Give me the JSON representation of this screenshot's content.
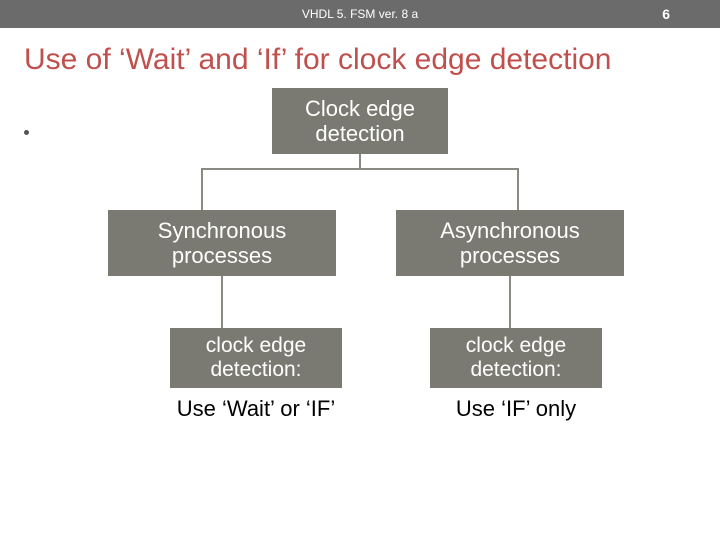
{
  "header": {
    "title": "VHDL 5. FSM ver. 8 a",
    "page_number": "6"
  },
  "slide": {
    "title": "Use of ‘Wait’ and ‘If’ for clock edge detection"
  },
  "diagram": {
    "root": "Clock edge detection",
    "level2": {
      "left": "Synchronous processes",
      "right": "Asynchronous processes"
    },
    "level3": {
      "left": "clock edge detection:",
      "right": "clock edge detection:"
    },
    "caption": {
      "left": "Use ‘Wait’ or ‘IF’",
      "right": "Use ‘IF’ only"
    }
  }
}
